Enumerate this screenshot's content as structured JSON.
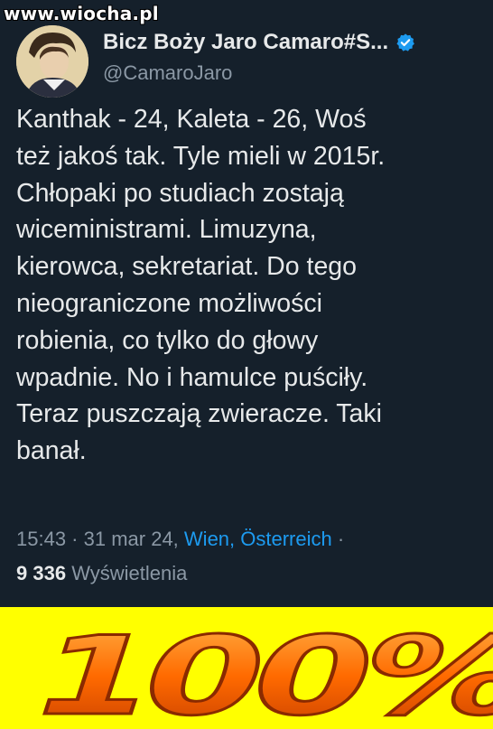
{
  "watermark": "www.wiocha.pl",
  "author": {
    "display_name": "Bicz Boży Jaro Camaro#S...",
    "handle": "@CamaroJaro",
    "verified": true
  },
  "tweet": {
    "text": "Kanthak - 24, Kaleta - 26, Woś\nteż jakoś tak. Tyle mieli w 2015r.\nChłopaki po studiach zostają\nwiceministrami. Limuzyna,\nkierowca, sekretariat. Do tego\nnieograniczone możliwości\nrobienia, co tylko do głowy\nwpadnie. No i hamulce puściły.\nTeraz puszczają zwieracze. Taki\nbanał.",
    "time": "15:43",
    "sep1": " · ",
    "date": "31 mar 24,",
    "location": "Wien, Österreich",
    "sep2": " ·",
    "views_count": "9 336",
    "views_label": "Wyświetlenia"
  },
  "banner": {
    "text": "100%"
  },
  "colors": {
    "background": "#15202b",
    "text": "#e7e9ea",
    "muted": "#8b98a5",
    "link": "#1d9bf0",
    "banner_bg": "#ffff00",
    "banner_text": "#ff6a00"
  },
  "icons": [
    "verified-badge-icon",
    "avatar-portrait"
  ]
}
